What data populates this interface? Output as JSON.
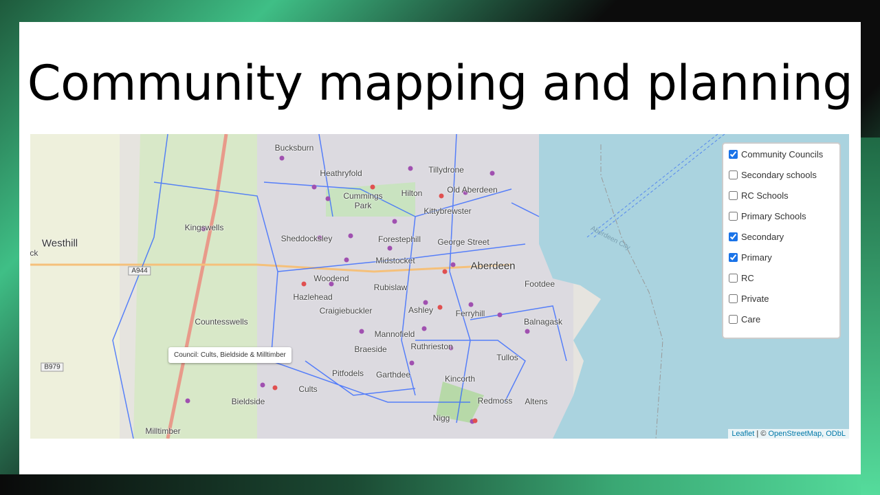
{
  "slide": {
    "title": "Community mapping and planning"
  },
  "map": {
    "places": [
      "Bucksburn",
      "Heathryfold",
      "Tillydrone",
      "Old Aberdeen",
      "Hilton",
      "Cummings\nPark",
      "Kittybrewster",
      "Kingswells",
      "Westhill",
      "Sheddocksley",
      "Forestерhill",
      "George Street",
      "Midstocket",
      "Aberdeen",
      "Woodend",
      "Rubislaw",
      "Footdee",
      "Hazlehead",
      "Craigiebuckler",
      "Ashley",
      "Ferryhill",
      "Balnagask",
      "Countesswells",
      "Mannofield",
      "Braeside",
      "Ruthrieston",
      "Tullos",
      "Pitfodels",
      "Garthdee",
      "Kincorth",
      "Cults",
      "Bieldside",
      "Redmoss",
      "Altens",
      "Nigg",
      "Milltimber",
      "ick"
    ],
    "road_shields": [
      "A944",
      "B979"
    ],
    "sea_label": "Aberdeen City",
    "tooltip": "Council: Cults, Bieldside & Milltimber",
    "colors": {
      "sea": "#aad3df",
      "boundary": "#3366ff",
      "secondary_marker": "#e05050",
      "primary_marker": "#a050b0",
      "land": "#e6e4df"
    }
  },
  "layer_control": {
    "items": [
      {
        "label": "Community Councils",
        "checked": true
      },
      {
        "label": "Secondary schools",
        "checked": false
      },
      {
        "label": "RC Schools",
        "checked": false
      },
      {
        "label": "Primary Schools",
        "checked": false
      },
      {
        "label": "Secondary",
        "checked": true
      },
      {
        "label": "Primary",
        "checked": true
      },
      {
        "label": "RC",
        "checked": false
      },
      {
        "label": "Private",
        "checked": false
      },
      {
        "label": "Care",
        "checked": false
      }
    ]
  },
  "attribution": {
    "leaflet": "Leaflet",
    "separator": " | © ",
    "osm": "OpenStreetMap, ODbL"
  }
}
